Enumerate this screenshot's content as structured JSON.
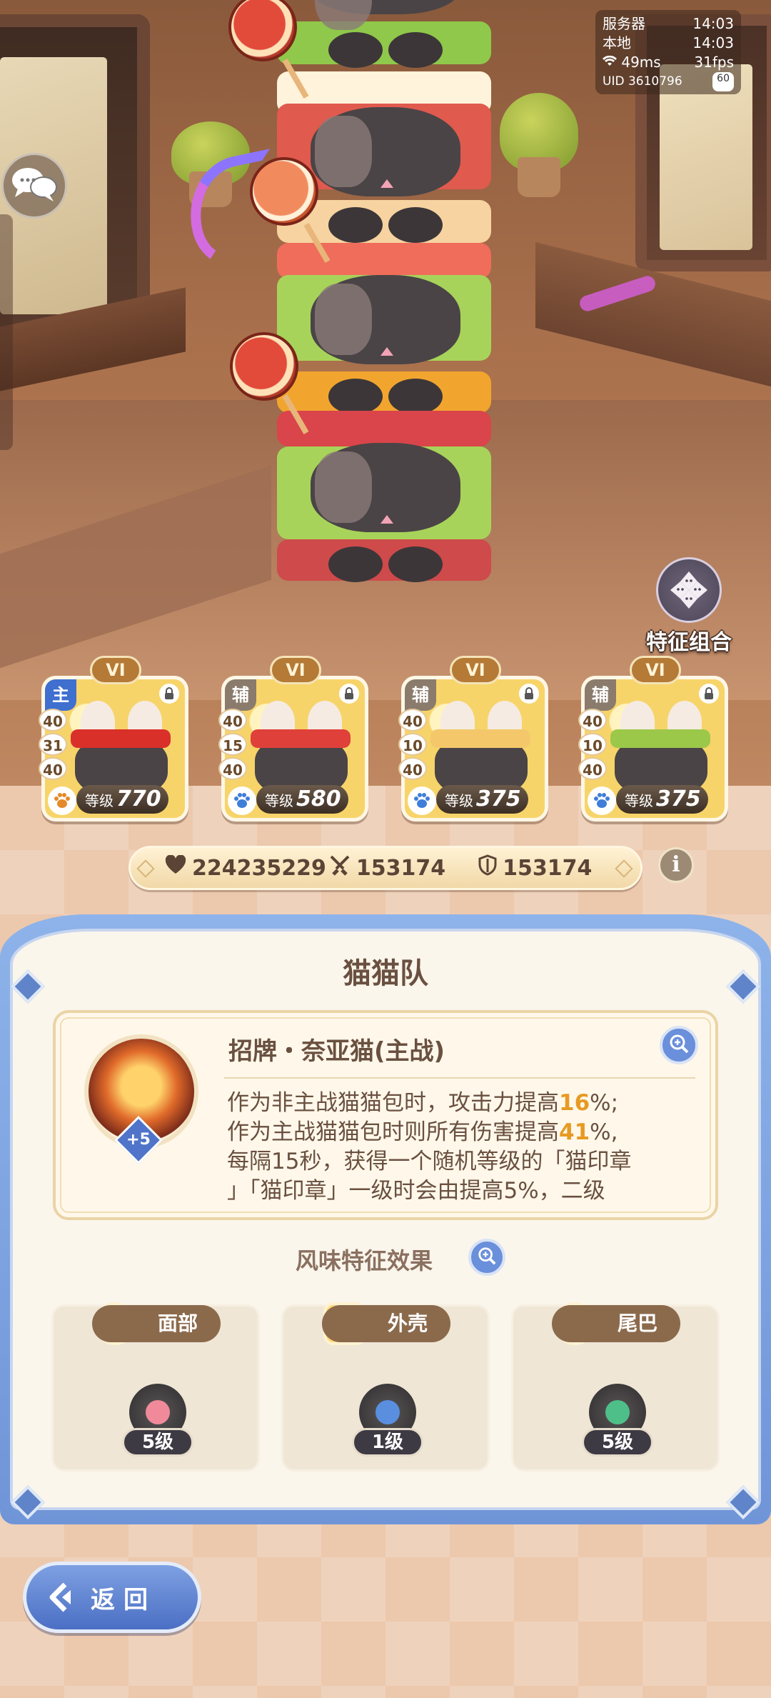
{
  "status": {
    "server_label": "服务器",
    "server_time": "14:03",
    "local_label": "本地",
    "local_time": "14:03",
    "ping": "49ms",
    "fps": "31fps",
    "uid": "UID 3610796",
    "battery": "60"
  },
  "feature_combo": {
    "label": "特征组合",
    "icon": "cat-faces-icon"
  },
  "cards": [
    {
      "rank": "VI",
      "role": "主",
      "stats": [
        "40",
        "31",
        "40"
      ],
      "level_label": "等级",
      "level": "770",
      "band_color": "#d9302a"
    },
    {
      "rank": "VI",
      "role": "辅",
      "stats": [
        "40",
        "15",
        "40"
      ],
      "level_label": "等级",
      "level": "580",
      "band_color": "#e0403a"
    },
    {
      "rank": "VI",
      "role": "辅",
      "stats": [
        "40",
        "10",
        "40"
      ],
      "level_label": "等级",
      "level": "375",
      "band_color": "#f4c86a"
    },
    {
      "rank": "VI",
      "role": "辅",
      "stats": [
        "40",
        "10",
        "40"
      ],
      "level_label": "等级",
      "level": "375",
      "band_color": "#9cc84a"
    }
  ],
  "power": {
    "hp": "224235229",
    "attack": "153174",
    "defense": "153174"
  },
  "info_button": "i",
  "panel": {
    "title": "猫猫队",
    "skill": {
      "name": "招牌・奈亚猫(主战)",
      "badge": "+5",
      "desc_1a": "作为非主战猫猫包时，攻击力提高",
      "desc_1b": "16",
      "desc_1c": "%;",
      "desc_2a": "作为主战猫猫包时则所有伤害提高",
      "desc_2b": "41",
      "desc_2c": "%,",
      "desc_3": "每隔15秒，获得一个随机等级的「猫印章",
      "desc_4": "」「猫印章」一级时会由提高5%，二级"
    },
    "flavor_title": "风味特征效果",
    "traits": [
      {
        "name": "面部",
        "level": "5级",
        "orb_color": "#f08a9a"
      },
      {
        "name": "外壳",
        "level": "1级",
        "orb_color": "#5a8fe0"
      },
      {
        "name": "尾巴",
        "level": "5级",
        "orb_color": "#4fbf8a"
      }
    ]
  },
  "back_button": {
    "label": "返回"
  },
  "colors": {
    "accent_blue": "#6f95d8",
    "highlight": "#e79a22",
    "text_brown": "#6a5040"
  }
}
